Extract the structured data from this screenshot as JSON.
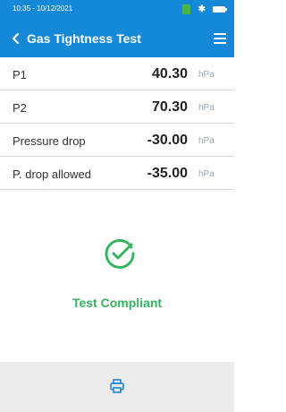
{
  "status_bar": {
    "datetime": "10:35 - 10/12/2021",
    "icons": [
      "battery-green-icon",
      "bluetooth-icon",
      "battery-icon"
    ],
    "bluetooth_glyph": "✱"
  },
  "header": {
    "title": "Gas Tightness Test",
    "back_icon": "chevron-left-icon",
    "menu_icon": "hamburger-menu-icon"
  },
  "measurements": [
    {
      "label": "P1",
      "value": "40.30",
      "unit": "hPa"
    },
    {
      "label": "P2",
      "value": "70.30",
      "unit": "hPa"
    },
    {
      "label": "Pressure drop",
      "value": "-30.00",
      "unit": "hPa"
    },
    {
      "label": "P. drop allowed",
      "value": "-35.00",
      "unit": "hPa"
    }
  ],
  "result": {
    "text": "Test Compliant",
    "icon": "check-circle-icon",
    "color": "#34b45f"
  },
  "footer": {
    "print_icon": "printer-icon"
  },
  "colors": {
    "header": "#1688d8",
    "accent": "#1688d8",
    "success": "#34b45f"
  }
}
